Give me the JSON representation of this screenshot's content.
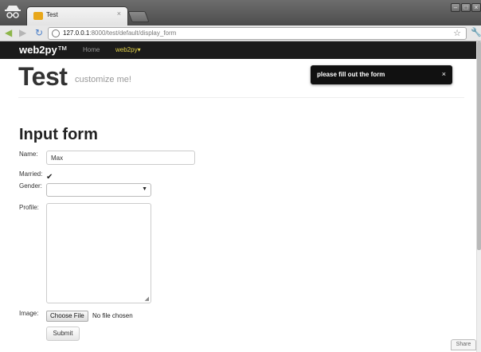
{
  "browser": {
    "tab_title": "Test",
    "tab_close": "×",
    "url_host": "127.0.0.1",
    "url_path": ":8000/test/default/display_form",
    "window_controls": [
      "–",
      "□",
      "×"
    ]
  },
  "navbar": {
    "brand": "web2py",
    "brand_tm": "™",
    "items": [
      "Home",
      "web2py▾"
    ]
  },
  "header": {
    "title": "Test",
    "subtitle": "customize me!"
  },
  "flash": {
    "message": "please fill out the form",
    "close": "×"
  },
  "form": {
    "title": "Input form",
    "name_label": "Name:",
    "name_value": "Max",
    "married_label": "Married:",
    "married_checked": "✔",
    "gender_label": "Gender:",
    "gender_value": "",
    "profile_label": "Profile:",
    "image_label": "Image:",
    "file_button": "Choose File",
    "file_status": "No file chosen",
    "submit": "Submit"
  },
  "share": "Share",
  "colors": {
    "navbar_bg": "#1b1b1b",
    "brand_accent": "#e2d24a",
    "flash_bg": "#111111"
  }
}
